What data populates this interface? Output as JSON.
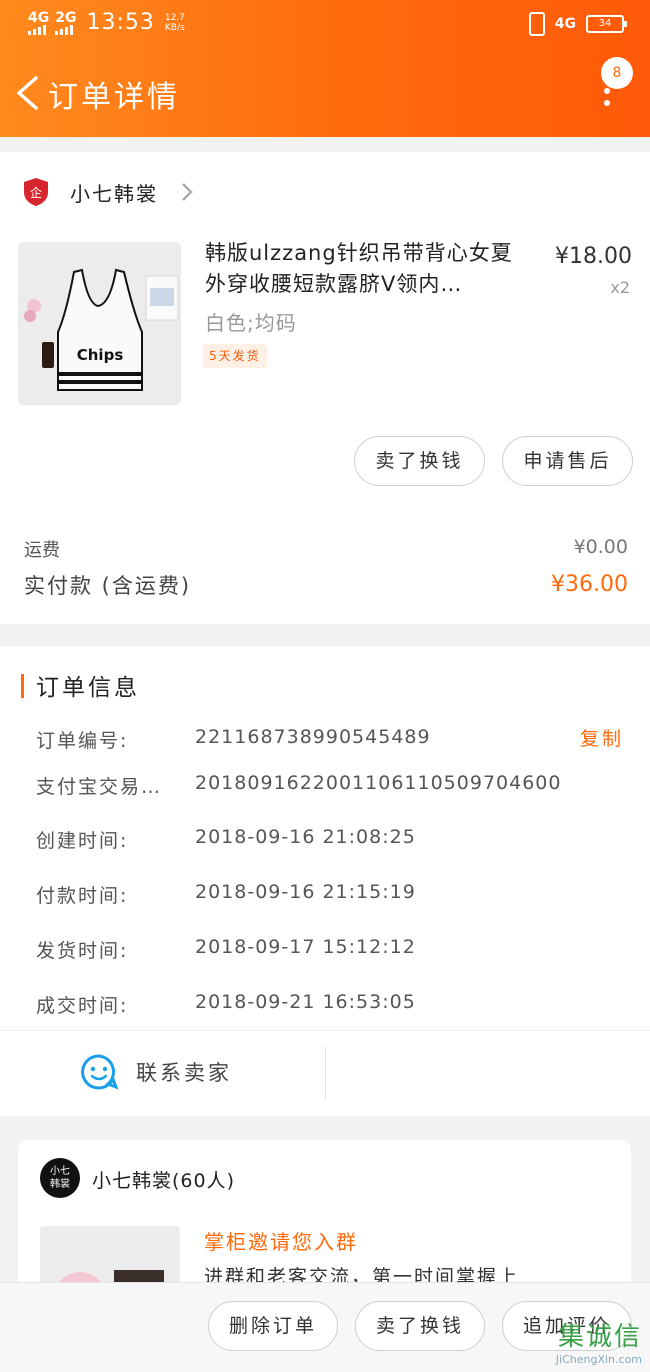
{
  "status_bar": {
    "net1": "4G",
    "net2": "2G",
    "time": "13:53",
    "speed_value": "12.7",
    "speed_unit": "KB/s",
    "net3": "4G",
    "battery": "34"
  },
  "header": {
    "title": "订单详情",
    "notify_count": "8"
  },
  "shop": {
    "name": "小七韩裳"
  },
  "product": {
    "title": "韩版ulzzang针织吊带背心女夏外穿收腰短款露脐V领内…",
    "price": "¥18.00",
    "qty": "x2",
    "spec": "白色;均码",
    "badge": "5天发货",
    "thumb_text": "Chips"
  },
  "item_actions": {
    "exchange": "卖了换钱",
    "after_sales": "申请售后"
  },
  "fees": {
    "shipping_label": "运费",
    "shipping_value": "¥0.00",
    "total_label": "实付款 (含运费)",
    "total_value": "¥36.00"
  },
  "order_info": {
    "title": "订单信息",
    "copy": "复制",
    "rows": [
      {
        "label": "订单编号:",
        "value": "221168738990545489"
      },
      {
        "label": "支付宝交易…",
        "value": "2018091622001106110509704600"
      },
      {
        "label": "创建时间:",
        "value": "2018-09-16 21:08:25"
      },
      {
        "label": "付款时间:",
        "value": "2018-09-16 21:15:19"
      },
      {
        "label": "发货时间:",
        "value": "2018-09-17 15:12:12"
      },
      {
        "label": "成交时间:",
        "value": "2018-09-21 16:53:05"
      }
    ]
  },
  "contact": {
    "label": "联系卖家"
  },
  "group": {
    "avatar_line1": "小七",
    "avatar_line2": "韩裳",
    "name": "小七韩裳(60人)",
    "invite_title": "掌柜邀请您入群",
    "invite_desc": "进群和老客交流，第一时间掌握上"
  },
  "bottom_bar": {
    "delete": "删除订单",
    "exchange": "卖了换钱",
    "review": "追加评价"
  },
  "watermark": {
    "main": "集诚信",
    "sub": "JiChengXin.com"
  },
  "colors": {
    "accent": "#ff6a0c",
    "header_start": "#ff8a1e",
    "chat_icon": "#1aa0e8"
  }
}
